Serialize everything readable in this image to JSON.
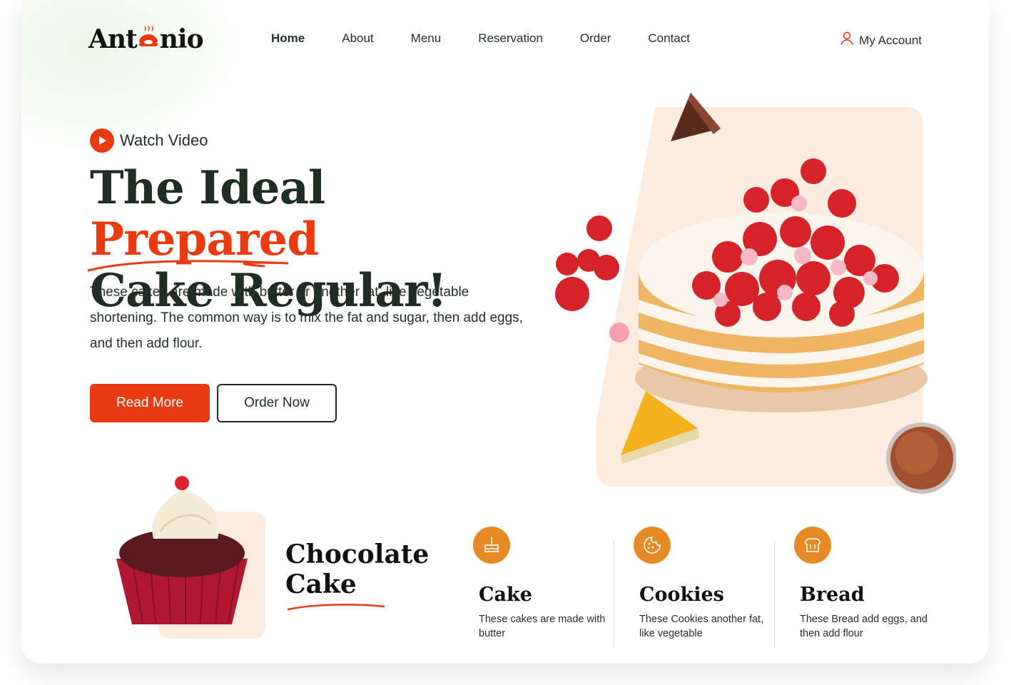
{
  "brand": {
    "logo_prefix": "Ant",
    "logo_suffix": "nio"
  },
  "nav": {
    "items": [
      {
        "label": "Home",
        "active": true
      },
      {
        "label": "About",
        "active": false
      },
      {
        "label": "Menu",
        "active": false
      },
      {
        "label": "Reservation",
        "active": false
      },
      {
        "label": "Order",
        "active": false
      },
      {
        "label": "Contact",
        "active": false
      }
    ],
    "account_label": "My Account"
  },
  "hero": {
    "watch_video_label": "Watch Video",
    "headline_part1": "The Ideal ",
    "headline_accent": "Prepared",
    "headline_part2": "Cake Regular!",
    "description": "These cakes are made with butter or another fat, like vegetable shortening. The common way is to mix the fat and sugar, then add eggs, and then add flour.",
    "read_more_label": "Read More",
    "order_now_label": "Order Now"
  },
  "featured": {
    "title_line1": "Chocolate",
    "title_line2": "Cake"
  },
  "categories": [
    {
      "title": "Cake",
      "text": "These cakes are made with butter",
      "icon": "cake-icon"
    },
    {
      "title": "Cookies",
      "text": "These Cookies another fat, like vegetable",
      "icon": "cookie-icon"
    },
    {
      "title": "Bread",
      "text": "These Bread add eggs, and then add flour",
      "icon": "bread-icon"
    }
  ],
  "colors": {
    "accent": "#ea3a12",
    "dark_green": "#1f2d24",
    "peach": "#fcebdf",
    "icon_orange": "#e58a25"
  }
}
